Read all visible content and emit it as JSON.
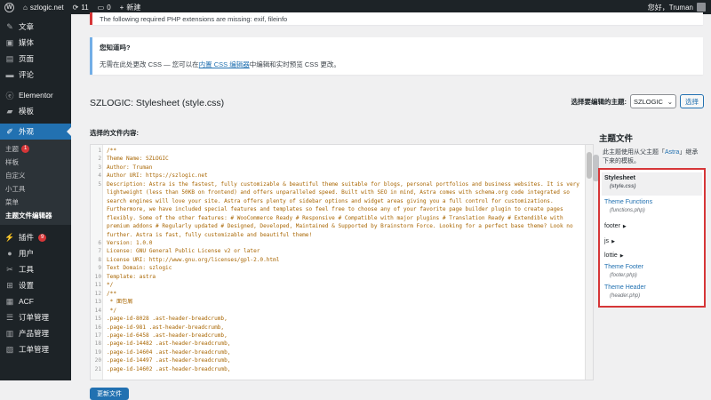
{
  "adminbar": {
    "site_name": "szlogic.net",
    "updates": "11",
    "comments": "0",
    "new_label": "新建",
    "greeting": "您好，Truman"
  },
  "sidebar": {
    "items": [
      {
        "label": "文章",
        "icon": "pin-icon"
      },
      {
        "label": "媒体",
        "icon": "media-icon"
      },
      {
        "label": "页面",
        "icon": "page-icon"
      },
      {
        "label": "评论",
        "icon": "comment-icon"
      },
      {
        "label": "Elementor",
        "icon": "elementor-icon"
      },
      {
        "label": "模板",
        "icon": "folder-icon"
      },
      {
        "label": "外观",
        "icon": "brush-icon"
      },
      {
        "label": "插件",
        "icon": "plugin-icon",
        "badge": "9"
      },
      {
        "label": "用户",
        "icon": "user-icon"
      },
      {
        "label": "工具",
        "icon": "wrench-icon"
      },
      {
        "label": "设置",
        "icon": "settings-icon"
      },
      {
        "label": "ACF",
        "icon": "acf-icon"
      },
      {
        "label": "订单管理",
        "icon": "orders-icon"
      },
      {
        "label": "产品管理",
        "icon": "products-icon"
      },
      {
        "label": "工单管理",
        "icon": "tickets-icon"
      }
    ],
    "submenu": [
      {
        "label": "主题",
        "badge": "1"
      },
      {
        "label": "样板"
      },
      {
        "label": "自定义"
      },
      {
        "label": "小工具"
      },
      {
        "label": "菜单"
      },
      {
        "label": "主题文件编辑器"
      }
    ]
  },
  "notices": {
    "error": "The following required PHP extensions are missing: exif, fileinfo",
    "info_title": "您知道吗?",
    "info_text_before": "无需在此处更改 CSS — 您可以在",
    "info_link": "内置 CSS 编辑器",
    "info_text_after": "中编辑和实时预览 CSS 更改。"
  },
  "editor": {
    "title": "SZLOGIC: Stylesheet (style.css)",
    "select_label": "选择要编辑的主题:",
    "selected_theme": "SZLOGIC",
    "select_button": "选择",
    "editing_label": "选择的文件内容:",
    "update_button": "更新文件",
    "lines": [
      {
        "n": "1",
        "t": "/**"
      },
      {
        "n": "2",
        "t": "Theme Name: SZLOGIC"
      },
      {
        "n": "3",
        "t": "Author: Truman"
      },
      {
        "n": "4",
        "t": "Author URI: https://szlogic.net"
      },
      {
        "n": "5",
        "t": "Description: Astra is the fastest, fully customizable & beautiful theme suitable for blogs, personal portfolios and business websites. It is very lightweight (less than 50KB on frontend) and offers unparalleled speed. Built with SEO in mind, Astra comes with schema.org code integrated so search engines will love your site. Astra offers plenty of sidebar options and widget areas giving you a full control for customizations. Furthermore, we have included special features and templates so feel free to choose any of your favorite page builder plugin to create pages flexibly. Some of the other features: # WooCommerce Ready # Responsive # Compatible with major plugins # Translation Ready # Extendible with premium addons # Regularly updated # Designed, Developed, Maintained & Supported by Brainstorm Force. Looking for a perfect base theme? Look no further. Astra is fast, fully customizable and beautiful theme!"
      },
      {
        "n": "6",
        "t": "Version: 1.0.0"
      },
      {
        "n": "7",
        "t": "License: GNU General Public License v2 or later"
      },
      {
        "n": "8",
        "t": "License URI: http://www.gnu.org/licenses/gpl-2.0.html"
      },
      {
        "n": "9",
        "t": "Text Domain: szlogic"
      },
      {
        "n": "10",
        "t": "Template: astra"
      },
      {
        "n": "11",
        "t": "*/"
      },
      {
        "n": "12",
        "t": "/**"
      },
      {
        "n": "13",
        "t": " * 面包屑"
      },
      {
        "n": "14",
        "t": " */"
      },
      {
        "n": "15",
        "t": ".page-id-8028 .ast-header-breadcrumb,"
      },
      {
        "n": "16",
        "t": ".page-id-981 .ast-header-breadcrumb,"
      },
      {
        "n": "17",
        "t": ".page-id-6458 .ast-header-breadcrumb,"
      },
      {
        "n": "18",
        "t": ".page-id-14482 .ast-header-breadcrumb,"
      },
      {
        "n": "19",
        "t": ".page-id-14604 .ast-header-breadcrumb,"
      },
      {
        "n": "20",
        "t": ".page-id-14497 .ast-header-breadcrumb,"
      },
      {
        "n": "21",
        "t": ".page-id-14602 .ast-header-breadcrumb,"
      }
    ]
  },
  "files": {
    "title": "主题文件",
    "desc_before": "此主题使用从父主题「",
    "desc_link": "Astra",
    "desc_after": "」继承下来的模板。",
    "items": [
      {
        "label": "Stylesheet",
        "sub": "(style.css)"
      },
      {
        "label": "Theme Functions",
        "sub": "(functions.php)"
      },
      {
        "label": "footer"
      },
      {
        "label": "js"
      },
      {
        "label": "lottie"
      },
      {
        "label": "Theme Footer",
        "sub": "(footer.php)"
      },
      {
        "label": "Theme Header",
        "sub": "(header.php)"
      }
    ]
  }
}
